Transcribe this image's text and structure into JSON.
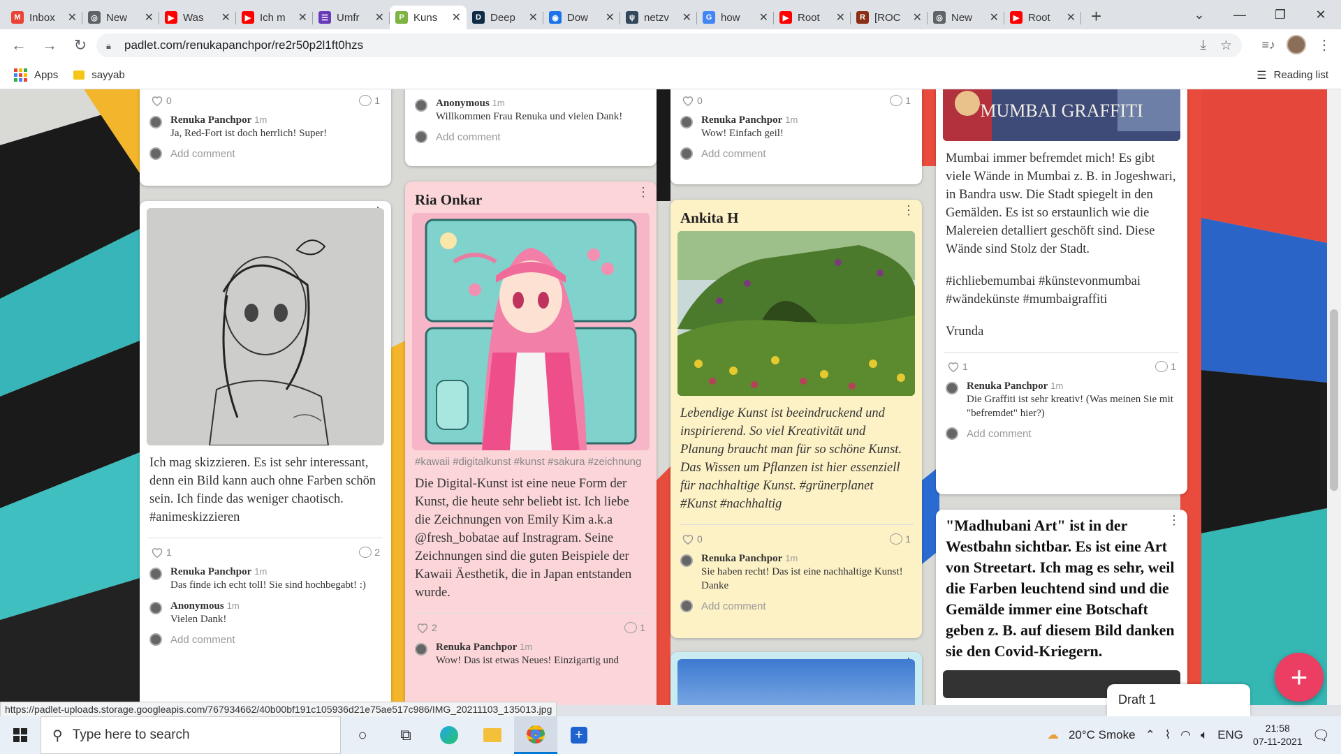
{
  "browser": {
    "tabs": [
      {
        "label": "Inbox",
        "favicon": "gmail-icon",
        "color": "#ea4335",
        "glyph": "M"
      },
      {
        "label": "New",
        "favicon": "chrome-icon",
        "color": "#5f6368",
        "glyph": "◎"
      },
      {
        "label": "Was",
        "favicon": "youtube-icon",
        "color": "#ff0000",
        "glyph": "▶"
      },
      {
        "label": "Ich m",
        "favicon": "youtube-icon",
        "color": "#ff0000",
        "glyph": "▶"
      },
      {
        "label": "Umfr",
        "favicon": "forms-icon",
        "color": "#673ab7",
        "glyph": "☰"
      },
      {
        "label": "Kuns",
        "favicon": "padlet-icon",
        "color": "#7cb342",
        "glyph": "P"
      },
      {
        "label": "Deep",
        "favicon": "deepl-icon",
        "color": "#0f2b46",
        "glyph": "D"
      },
      {
        "label": "Dow",
        "favicon": "download-icon",
        "color": "#1a73e8",
        "glyph": "◉"
      },
      {
        "label": "netzv",
        "favicon": "netz-icon",
        "color": "#33475b",
        "glyph": "ψ"
      },
      {
        "label": "how",
        "favicon": "google-icon",
        "color": "#4285f4",
        "glyph": "G"
      },
      {
        "label": "Root",
        "favicon": "youtube-icon",
        "color": "#ff0000",
        "glyph": "▶"
      },
      {
        "label": "[ROC",
        "favicon": "roc-icon",
        "color": "#8b2e16",
        "glyph": "R"
      },
      {
        "label": "New",
        "favicon": "chrome-icon",
        "color": "#5f6368",
        "glyph": "◎"
      },
      {
        "label": "Root",
        "favicon": "youtube-icon",
        "color": "#ff0000",
        "glyph": "▶"
      }
    ],
    "url": "padlet.com/renukapanchpor/re2r50p2l1ft0hzs",
    "bookmarks": {
      "apps": "Apps",
      "folder": "sayyab",
      "reading_list": "Reading list"
    },
    "status_url": "https://padlet-uploads.storage.googleapis.com/767934662/40b00bf191c105936d21e75ae517c986/IMG_20211103_135013.jpg"
  },
  "padlet": {
    "col1_top": {
      "likes": "0",
      "comments": "1",
      "comment": {
        "name": "Renuka Panchpor",
        "time": "1m",
        "text": "Ja, Red-Fort ist doch herrlich! Super!"
      },
      "add_comment": "Add comment"
    },
    "col1_sketch": {
      "body": "Ich mag skizzieren. Es ist sehr interessant, denn ein Bild kann auch ohne Farben schön sein. Ich finde das weniger chaotisch. #animeskizzieren",
      "likes": "1",
      "comments": "2",
      "comments_list": [
        {
          "name": "Renuka Panchpor",
          "time": "1m",
          "text": "Das finde ich echt toll! Sie sind hochbegabt! :)"
        },
        {
          "name": "Anonymous",
          "time": "1m",
          "text": "Vielen Dank!"
        }
      ],
      "add_comment": "Add comment"
    },
    "col2_top": {
      "comment": {
        "name": "Anonymous",
        "time": "1m",
        "text": "Willkommen Frau Renuka und vielen Dank!"
      },
      "add_comment": "Add comment"
    },
    "col2_ria": {
      "title": "Ria Onkar",
      "tags": "#kawaii #digitalkunst #kunst #sakura #zeichnung",
      "body": "Die Digital-Kunst ist eine neue Form der Kunst, die heute sehr beliebt ist. Ich liebe die Zeichnungen von Emily Kim a.k.a @fresh_bobatae auf Instragram. Seine Zeichnungen sind die guten Beispiele der Kawaii Äesthetik, die in Japan entstanden wurde.",
      "likes": "2",
      "comments": "1",
      "comment": {
        "name": "Renuka Panchpor",
        "time": "1m",
        "text": "Wow! Das ist etwas Neues! Einzigartig und"
      }
    },
    "col3_top": {
      "likes": "0",
      "comments": "1",
      "comment": {
        "name": "Renuka Panchpor",
        "time": "1m",
        "text": "Wow! Einfach geil!"
      },
      "add_comment": "Add comment"
    },
    "col3_ankita": {
      "title": "Ankita H",
      "body": "Lebendige Kunst ist beeindruckend und inspirierend.  So viel Kreativität und Planung braucht man für so schöne Kunst.  Das Wissen um Pflanzen ist hier essenziell für nachhaltige Kunst. #grünerplanet  #Kunst #nachhaltig",
      "likes": "0",
      "comments": "1",
      "comment": {
        "name": "Renuka Panchpor",
        "time": "1m",
        "text": "Sie haben recht! Das ist eine nachhaltige Kunst! Danke"
      },
      "add_comment": "Add comment"
    },
    "col4_mumbai": {
      "image_text": "MUMBAI GRAFFITI",
      "body1": "Mumbai immer befremdet mich! Es gibt viele Wände in Mumbai z. B. in Jogeshwari, in Bandra usw. Die Stadt spiegelt in den Gemälden. Es ist so erstaunlich wie die Malereien detalliert geschöft sind. Diese Wände sind Stolz der Stadt.",
      "body2": "#ichliebemumbai #künstevonmumbai #wändekünste #mumbaigraffiti",
      "body3": "Vrunda",
      "likes": "1",
      "comments": "1",
      "comment": {
        "name": "Renuka Panchpor",
        "time": "1m",
        "text": "Die Graffiti ist sehr kreativ! (Was meinen Sie mit \"befremdet\" hier?)"
      },
      "add_comment": "Add comment"
    },
    "col4_madhubani": {
      "body": "\"Madhubani Art\" ist in der Westbahn sichtbar. Es ist eine Art von Streetart. Ich mag es sehr, weil die Farben leuchtend sind und die Gemälde immer eine Botschaft geben z. B. auf diesem Bild danken sie den Covid-Kriegern."
    },
    "draft": "Draft 1",
    "fab": "+"
  },
  "taskbar": {
    "search_placeholder": "Type here to search",
    "weather": "20°C  Smoke",
    "lang": "ENG",
    "time": "21:58",
    "date": "07-11-2021"
  }
}
